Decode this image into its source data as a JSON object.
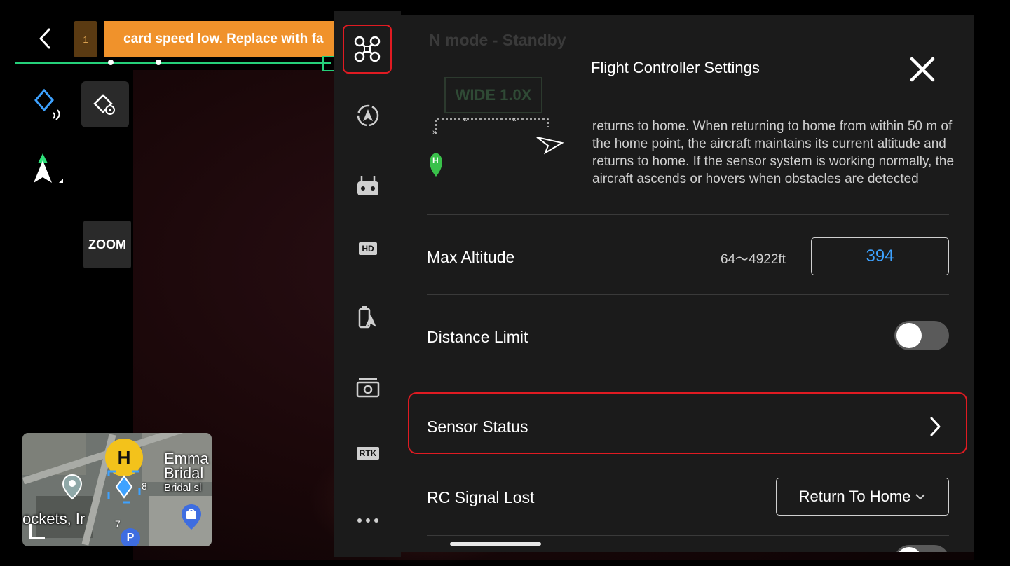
{
  "banner": {
    "card_index": "1",
    "warning_text": "card speed low. Replace with fa"
  },
  "left_controls": {
    "zoom_label": "ZOOM"
  },
  "mini_map": {
    "home_marker": "H",
    "place_label_line1": "Emma",
    "place_label_line2": "Bridal",
    "place_label_line3": "Bridal sl",
    "place_label_bottom": "ockets, Ir",
    "parking_marker": "P",
    "waypoint_8": "8",
    "waypoint_7": "7"
  },
  "icon_rail": {
    "items": [
      {
        "name": "aircraft-settings",
        "icon": "drone-icon"
      },
      {
        "name": "obstacle-avoidance",
        "icon": "radar-icon"
      },
      {
        "name": "remote-controller",
        "icon": "controller-icon"
      },
      {
        "name": "video-transmission",
        "icon": "hd-icon",
        "label": "HD"
      },
      {
        "name": "battery",
        "icon": "battery-icon"
      },
      {
        "name": "camera",
        "icon": "camera-icon"
      },
      {
        "name": "rtk",
        "icon": "rtk-icon",
        "label": "RTK"
      },
      {
        "name": "more",
        "icon": "more-icon"
      }
    ]
  },
  "background_status": {
    "flight_mode": "N mode - Standby",
    "camera_mode": "WIDE  1.0X"
  },
  "panel": {
    "title": "Flight Controller Settings",
    "rth_description": "returns to home. When returning to home from within 50 m of the home point, the aircraft maintains its current altitude and returns to home. If the sensor system is working normally, the aircraft ascends or hovers when obstacles are detected",
    "rth_home_marker": "H",
    "max_altitude": {
      "label": "Max Altitude",
      "range": "64～4922ft",
      "value": "394"
    },
    "distance_limit": {
      "label": "Distance Limit",
      "enabled": false
    },
    "sensor_status": {
      "label": "Sensor Status"
    },
    "rc_signal_lost": {
      "label": "RC Signal Lost",
      "selected": "Return To Home"
    }
  },
  "colors": {
    "highlight_red": "#e01b22",
    "accent_blue": "#3ea2ff",
    "warning_orange": "#f0922b",
    "route_green": "#25d07a"
  }
}
